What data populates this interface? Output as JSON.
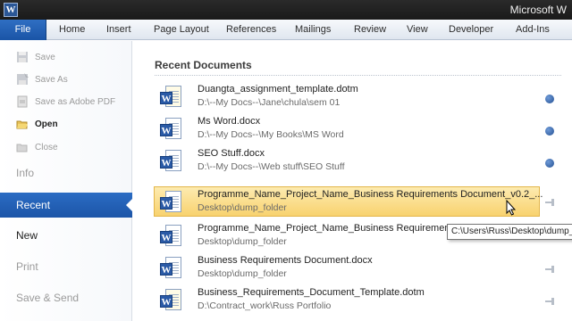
{
  "window": {
    "title": "Microsoft W"
  },
  "ribbon": {
    "file_label": "File",
    "tabs": [
      "Home",
      "Insert",
      "Page Layout",
      "References",
      "Mailings",
      "Review",
      "View",
      "Developer",
      "Add-Ins"
    ]
  },
  "nav": {
    "save": "Save",
    "save_as": "Save As",
    "save_pdf": "Save as Adobe PDF",
    "open": "Open",
    "close": "Close",
    "info": "Info",
    "recent": "Recent",
    "new": "New",
    "print": "Print",
    "save_send": "Save & Send"
  },
  "main": {
    "section_title": "Recent Documents",
    "documents": [
      {
        "name": "Duangta_assignment_template.dotm",
        "path": "D:\\--My Docs--\\Jane\\chula\\sem 01",
        "pinned": true
      },
      {
        "name": "Ms Word.docx",
        "path": "D:\\--My Docs--\\My Books\\MS Word",
        "pinned": true
      },
      {
        "name": "SEO Stuff.docx",
        "path": "D:\\--My Docs--\\Web stuff\\SEO Stuff",
        "pinned": true
      },
      {
        "name": "Programme_Name_Project_Name_Business Requirements Document_v0.2_...",
        "path": "Desktop\\dump_folder",
        "pinned": false
      },
      {
        "name": "Programme_Name_Project_Name_Business Requirements",
        "path": "Desktop\\dump_folder",
        "pinned": false
      },
      {
        "name": "Business Requirements Document.docx",
        "path": "Desktop\\dump_folder",
        "pinned": false
      },
      {
        "name": "Business_Requirements_Document_Template.dotm",
        "path": "D:\\Contract_work\\Russ Portfolio",
        "pinned": false
      }
    ],
    "tooltip": "C:\\Users\\Russ\\Desktop\\dump_folder"
  },
  "colors": {
    "accent": "#1c55a8",
    "highlight": "#f8d26f"
  }
}
